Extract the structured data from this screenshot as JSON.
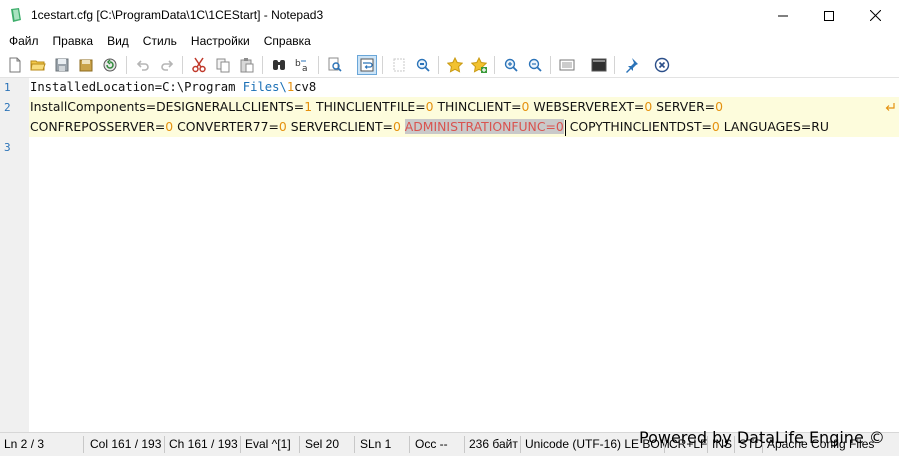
{
  "window": {
    "title": "1cestart.cfg [C:\\ProgramData\\1C\\1CEStart] - Notepad3",
    "app_icon": "notepad3-icon"
  },
  "menu": [
    "Файл",
    "Правка",
    "Вид",
    "Стиль",
    "Настройки",
    "Справка"
  ],
  "toolbar": {
    "buttons": [
      "new-file-icon",
      "open-file-icon",
      "save-icon",
      "save-as-icon",
      "revert-icon",
      "undo-icon",
      "redo-icon",
      "cut-icon",
      "copy-icon",
      "paste-icon",
      "find-icon",
      "replace-icon",
      "find-next-icon",
      "word-wrap-icon",
      "zoom-fit-icon",
      "zoom-icon",
      "favorite-icon",
      "add-favorite-icon",
      "zoom-in-icon",
      "zoom-out-icon",
      "schema-icon",
      "console-icon",
      "pin-icon",
      "close-file-icon"
    ],
    "active": "word-wrap-icon"
  },
  "editor": {
    "line_numbers": [
      "1",
      "2",
      "3"
    ],
    "line1": {
      "a": "InstalledLocation=C:\\Program ",
      "b": "Files",
      "c": "\\",
      "d": "1",
      "e": "cv8"
    },
    "line2a": {
      "t1": "InstallComponents=DESIGNERALLCLIENTS=",
      "n1": "1",
      "t2": " THINCLIENTFILE=",
      "n2": "0",
      "t3": " THINCLIENT=",
      "n3": "0",
      "t4": " WEBSERVEREXT=",
      "n4": "0",
      "t5": " SERVER=",
      "n5": "0"
    },
    "line2b": {
      "t1": "CONFREPOSSERVER=",
      "n1": "0",
      "t2": " CONVERTER77=",
      "n2": "0",
      "t3": " SERVERCLIENT=",
      "n3": "0",
      "t4": " ",
      "sel": "ADMINISTRATIONFUNC=0",
      "t5": " COPYTHINCLIENTDST=",
      "n5": "0",
      "t6": " LANGUAGES=RU"
    }
  },
  "status": {
    "ln": "Ln  2 / 3",
    "col": "Col  161 / 193",
    "ch": "Ch  161 / 193",
    "eval": "Eval  ^[1]",
    "sel": "Sel  20",
    "sln": "SLn  1",
    "occ": "Occ  --",
    "size": "236 байт",
    "encoding": "Unicode (UTF-16) LE BOM",
    "eol": "CR+LF",
    "ins": "INS",
    "std": "STD",
    "lexer": "Apache Config Files"
  },
  "watermark": "Powered by DataLife Engine ©"
}
